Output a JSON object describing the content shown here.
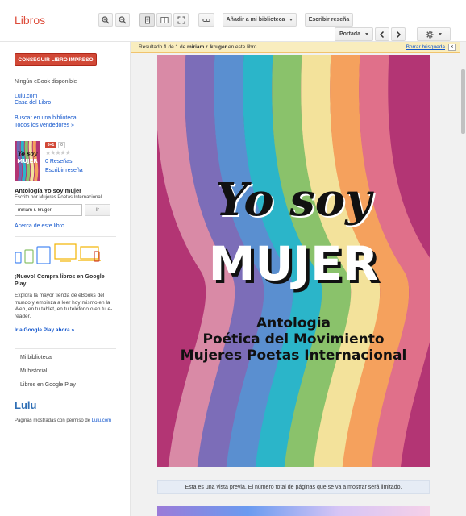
{
  "header": {
    "app_title": "Libros",
    "add_library_label": "Añadir a mi biblioteca",
    "write_review_label": "Escribir reseña",
    "portada_label": "Portada"
  },
  "notice": {
    "message_prefix": "Resultado ",
    "result_num": "1",
    "message_mid": " de ",
    "result_total": "1",
    "message_mid2": " de ",
    "query": "miriam r. kruger",
    "message_suffix": " en este libro",
    "clear_label": "Borrar búsqueda",
    "close_symbol": "×"
  },
  "sidebar": {
    "get_book_button": "CONSEGUIR LIBRO IMPRESO",
    "no_ebook": "Ningún eBook disponible",
    "seller_1": "Lulu.com",
    "seller_2": "Casa del Libro",
    "search_library": "Buscar en una biblioteca",
    "all_sellers": "Todos los vendedores »",
    "gplus_label": "8+1",
    "gplus_count": "0",
    "stars": "★★★★★",
    "reviews_label": "0 Reseñas",
    "write_review": "Escribir reseña",
    "book_title": "Antología Yo soy mujer",
    "book_author": "Escrito por Mujeres Poetas Internacional",
    "search_value": "miriam r. kruger",
    "search_button": "Ir",
    "about_book": "Acerca de este libro",
    "promo_new": "¡Nuevo! Compra libros en Google Play",
    "promo_text": "Explora la mayor tienda de eBooks del mundo y empieza a leer hoy mismo en la Web, en tu tablet, en tu teléfono o en tu e-reader.",
    "promo_link": "Ir a Google Play ahora »",
    "nav": [
      "Mi biblioteca",
      "Mi historial",
      "Libros en Google Play"
    ],
    "publisher_logo": "Lulu",
    "permission_prefix": "Páginas mostradas con permiso de ",
    "permission_link": "Lulu.com"
  },
  "cover": {
    "line1": "Yo soy",
    "line2": "MUJER",
    "line3": "Antologia",
    "line4": "Poética del Movimiento",
    "line5": "Mujeres Poetas Internacional"
  },
  "preview_note": "Esta es una vista previa. El número total de páginas que se va a mostrar será limitado.",
  "colors": {
    "accent_red": "#dd4b39",
    "button_red": "#d14836",
    "link_blue": "#1155cc",
    "notice_yellow": "#f9edbe",
    "cover_bg": "#b33574"
  }
}
